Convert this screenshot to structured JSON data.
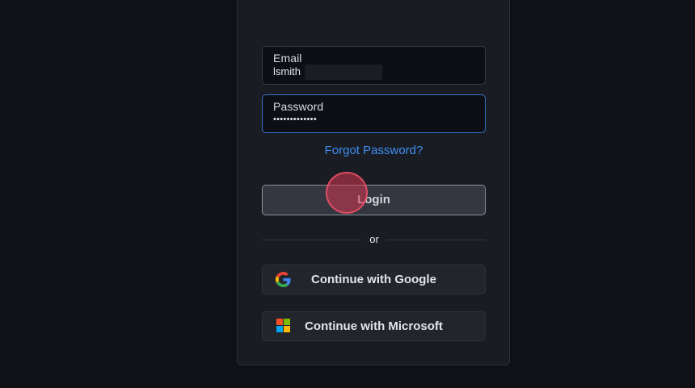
{
  "login_form": {
    "email": {
      "label": "Email",
      "value": "lsmith"
    },
    "password": {
      "label": "Password",
      "value": "•••••••••••••"
    },
    "forgot_password_label": "Forgot Password?",
    "login_button_label": "Login",
    "divider_text": "or",
    "social": {
      "google_label": "Continue with Google",
      "microsoft_label": "Continue with Microsoft"
    }
  },
  "icons": {
    "google": "google-icon",
    "microsoft": "microsoft-icon"
  },
  "colors": {
    "background": "#0f1117",
    "card": "#191c23",
    "accent_link": "#3f8ef2",
    "focused_border": "#3b6fd1",
    "click_marker": "#d63852"
  }
}
